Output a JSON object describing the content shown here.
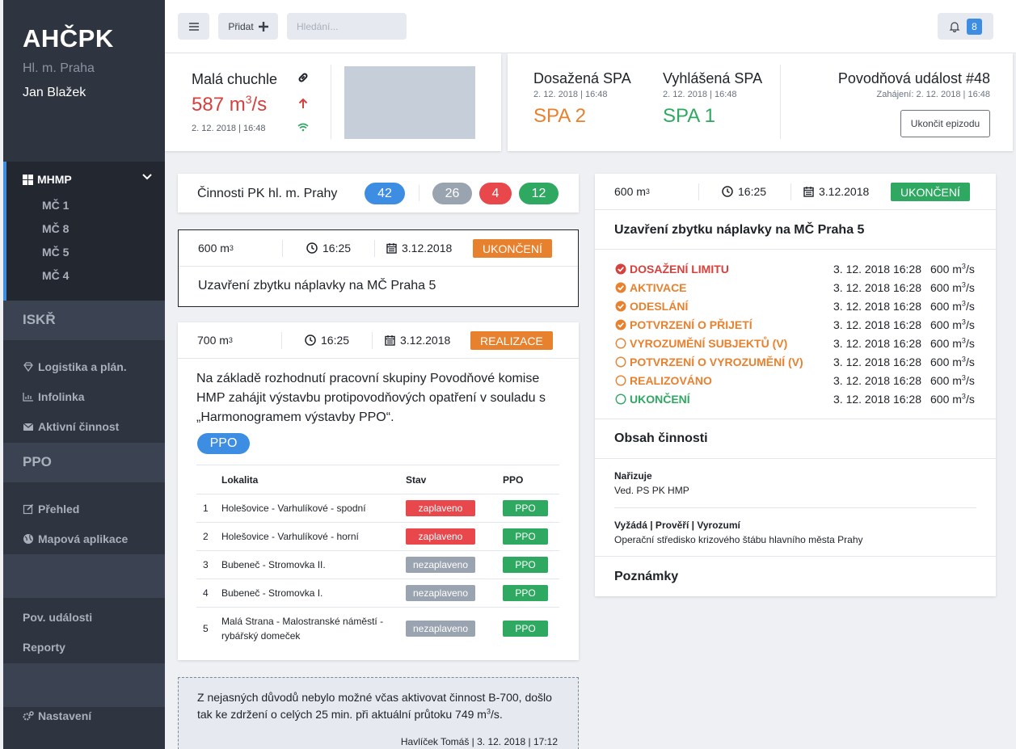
{
  "sidebar": {
    "logo": "AHČPK",
    "city": "Hl. m. Praha",
    "user": "Jan Blažek",
    "mhmp": {
      "label": "MHMP",
      "items": [
        "MČ 1",
        "MČ 8",
        "MČ 5",
        "MČ 4"
      ]
    },
    "iskr": {
      "label": "ISKŘ",
      "items": [
        "Logistika a plán.",
        "Infolinka",
        "Aktivní činnost"
      ]
    },
    "ppo": {
      "label": "PPO",
      "items": [
        "Přehled",
        "Mapová aplikace"
      ]
    },
    "bottom_items": [
      "Pov. události",
      "Reporty"
    ],
    "settings": "Nastavení"
  },
  "topbar": {
    "add_label": "Přidat",
    "search_placeholder": "Hledání...",
    "notification_count": "8"
  },
  "river": {
    "name": "Malá chuchle",
    "flow_value": "587 m",
    "flow_exp": "3",
    "flow_unit": "/s",
    "date": "2. 12. 2018 | 16:48"
  },
  "spa": {
    "reached_label": "Dosažená SPA",
    "reached_date": "2. 12. 2018 | 16:48",
    "reached_value": "SPA 2",
    "declared_label": "Vyhlášená SPA",
    "declared_date": "2. 12. 2018 | 16:48",
    "declared_value": "SPA 1",
    "flood_title": "Povodňová událost #48",
    "flood_start": "Zahájení: 2. 12. 2018 | 16:48",
    "end_button": "Ukončit epizodu"
  },
  "activities_header": {
    "title": "Činnosti PK hl. m. Prahy",
    "counts": [
      "42",
      "26",
      "4",
      "12"
    ]
  },
  "activity1": {
    "volume": "600 m",
    "volume_exp": "3",
    "time": "16:25",
    "date": "3.12.2018",
    "status": "UKONČENÍ",
    "title": "Uzavření zbytku náplavky na MČ Praha 5"
  },
  "activity2": {
    "volume": "700 m",
    "volume_exp": "3",
    "time": "16:25",
    "date": "3.12.2018",
    "status": "REALIZACE",
    "description": "Na základě rozhodnutí pracovní skupiny Povodňové komise HMP zahájit výstavbu protipovodňových opatření v souladu s „Harmonogramem výstavby PPO“.",
    "tag": "PPO",
    "table_headers": [
      "",
      "Lokalita",
      "Stav",
      "PPO"
    ],
    "rows": [
      {
        "n": "1",
        "locality": "Holešovice - Varhulíkové - spodní",
        "state": "zaplaveno",
        "ppo": "PPO"
      },
      {
        "n": "2",
        "locality": "Holešovice - Varhulíkové - horní",
        "state": "zaplaveno",
        "ppo": "PPO"
      },
      {
        "n": "3",
        "locality": "Bubeneč - Stromovka II.",
        "state": "nezaplaveno",
        "ppo": "PPO"
      },
      {
        "n": "4",
        "locality": "Bubeneč - Stromovka I.",
        "state": "nezaplaveno",
        "ppo": "PPO"
      },
      {
        "n": "5",
        "locality": "Malá Strana - Malostranské náměstí - rybářský domeček",
        "state": "nezaplaveno",
        "ppo": "PPO"
      }
    ]
  },
  "note": {
    "text_before": "Z nejasných důvodů nebylo možné včas aktivovat činnost B-700, došlo tak ke zdržení o celých 25 min. při aktuální průtoku 749 m",
    "text_exp": "3",
    "text_after": "/s.",
    "author": "Havlíček Tomáš | 3. 12. 2018 | 17:12"
  },
  "detail": {
    "volume": "600 m",
    "volume_exp": "3",
    "time": "16:25",
    "date": "3.12.2018",
    "status": "UKONČENÍ",
    "title": "Uzavření zbytku náplavky na MČ Praha 5",
    "steps": [
      {
        "label": "DOSAŽENÍ LIMITU",
        "date": "3. 12. 2018 16:28",
        "flow": "600 m",
        "exp": "3",
        "unit": "/s",
        "done": true,
        "color": "#d6403d"
      },
      {
        "label": "AKTIVACE",
        "date": "3. 12. 2018 16:28",
        "flow": "600 m",
        "exp": "3",
        "unit": "/s",
        "done": true,
        "color": "#e8812e"
      },
      {
        "label": "ODESLÁNÍ",
        "date": "3. 12. 2018 16:28",
        "flow": "600 m",
        "exp": "3",
        "unit": "/s",
        "done": true,
        "color": "#e8812e"
      },
      {
        "label": "POTVRZENÍ O PŘIJETÍ",
        "date": "3. 12. 2018 16:28",
        "flow": "600 m",
        "exp": "3",
        "unit": "/s",
        "done": true,
        "color": "#e8812e"
      },
      {
        "label": "VYROZUMĚNÍ SUBJEKTŮ (V)",
        "date": "3. 12. 2018 16:28",
        "flow": "600 m",
        "exp": "3",
        "unit": "/s",
        "done": false,
        "color": "#e8812e"
      },
      {
        "label": "POTVRZENÍ O VYROZUMĚNÍ (V)",
        "date": "3. 12. 2018 16:28",
        "flow": "600 m",
        "exp": "3",
        "unit": "/s",
        "done": false,
        "color": "#e8812e"
      },
      {
        "label": "REALIZOVÁNO",
        "date": "3. 12. 2018 16:28",
        "flow": "600 m",
        "exp": "3",
        "unit": "/s",
        "done": false,
        "color": "#e8812e"
      },
      {
        "label": "UKONČENÍ",
        "date": "3. 12. 2018 16:28",
        "flow": "600 m",
        "exp": "3",
        "unit": "/s",
        "done": false,
        "color": "#2fa862"
      }
    ],
    "content_title": "Obsah činnosti",
    "orders_label": "Nařizuje",
    "orders_value": "Ved. PS PK HMP",
    "checks_label": "Vyžádá | Prověří | Vyrozumí",
    "checks_value": "Operační středisko krizového štábu hlavního města Prahy",
    "notes_title": "Poznámky"
  },
  "colors": {
    "red": "#d6403d",
    "orange": "#e8812e",
    "green": "#2fa862",
    "blue": "#3d8de2",
    "grey": "#9aa3b0"
  }
}
